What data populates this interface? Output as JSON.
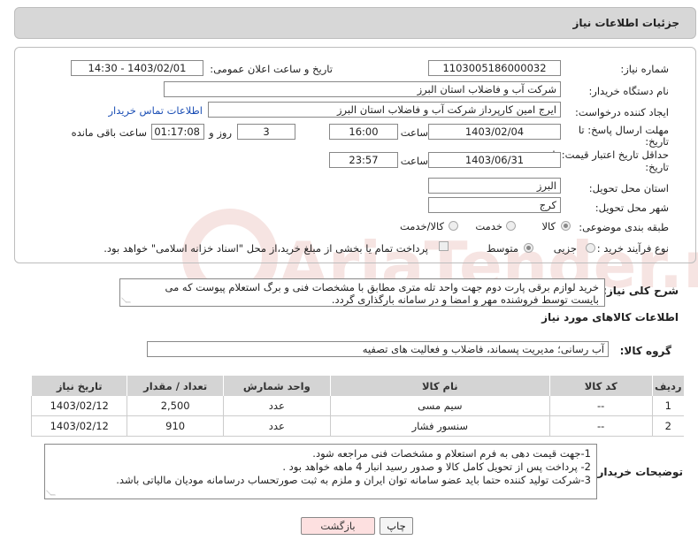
{
  "header": {
    "title": "جزئیات اطلاعات نیاز"
  },
  "form": {
    "need_number": {
      "label": "شماره نیاز:",
      "value": "1103005186000032"
    },
    "announce": {
      "label": "تاریخ و ساعت اعلان عمومی:",
      "value": "1403/02/01 - 14:30"
    },
    "buyer_org": {
      "label": "نام دستگاه خریدار:",
      "value": "شرکت آب و فاضلاب استان البرز"
    },
    "requester": {
      "label": "ایجاد کننده درخواست:",
      "value": "ایرج امین کارپرداز شرکت آب و فاضلاب استان البرز",
      "contact_link": "اطلاعات تماس خریدار"
    },
    "reply_deadline": {
      "label_line1": "مهلت ارسال پاسخ: تا",
      "label_line2": "تاریخ:",
      "date": "1403/02/04",
      "time_label": "ساعت",
      "time": "16:00",
      "days": "3",
      "days_label": "روز و",
      "remaining": "01:17:08",
      "remaining_label": "ساعت باقی مانده"
    },
    "price_validity": {
      "label_line1": "حداقل تاریخ اعتبار قیمت: تا",
      "label_line2": "تاریخ:",
      "date": "1403/06/31",
      "time_label": "ساعت",
      "time": "23:57"
    },
    "province": {
      "label": "استان محل تحویل:",
      "value": "البرز"
    },
    "city": {
      "label": "شهر محل تحویل:",
      "value": "کرج"
    },
    "category": {
      "label": "طبقه بندی موضوعی:",
      "options": [
        "کالا",
        "خدمت",
        "کالا/خدمت"
      ],
      "selected": "کالا"
    },
    "purchase_type": {
      "label": "نوع فرآیند خرید :",
      "options": [
        "جزیی",
        "متوسط"
      ],
      "selected": "متوسط",
      "note": "پرداخت تمام یا بخشی از مبلغ خرید،از محل \"اسناد خزانه اسلامی\" خواهد بود."
    }
  },
  "description": {
    "label": "شرح کلی نیاز:",
    "text_line1": "خرید لوازم برقی پارت دوم جهت  واحد تله متری مطابق با مشخصات فنی و برگ استعلام پیوست که می",
    "text_line2": "بایست توسط فروشنده مهر و امضا و در سامانه بارگذاری گردد."
  },
  "goods_section": {
    "title": "اطلاعات کالاهای مورد نیاز",
    "group_label": "گروه کالا:",
    "group_value": "آب رسانی؛ مدیریت پسماند، فاضلاب و فعالیت های تصفیه"
  },
  "table": {
    "headers": [
      "ردیف",
      "کد کالا",
      "نام کالا",
      "واحد شمارش",
      "تعداد / مقدار",
      "تاریخ نیاز"
    ],
    "rows": [
      [
        "1",
        "--",
        "سیم مسی",
        "عدد",
        "2,500",
        "1403/02/12"
      ],
      [
        "2",
        "--",
        "سنسور فشار",
        "عدد",
        "910",
        "1403/02/12"
      ]
    ]
  },
  "buyer_notes": {
    "label": "توضیحات خریدار:",
    "line1": "1-جهت قیمت دهی به فرم استعلام و مشخصات فنی مراجعه شود.",
    "line2": "2- پرداخت پس از تحویل کامل کالا و صدور رسید انبار 4 ماهه خواهد بود .",
    "line3": "3-شرکت تولید کننده حتما باید عضو سامانه توان ایران و ملزم به ثبت صورتحساب درسامانه مودیان مالیاتی باشد."
  },
  "buttons": {
    "print": "چاپ",
    "back": "بازگشت"
  },
  "watermark": {
    "text": "AriaTender.net"
  }
}
